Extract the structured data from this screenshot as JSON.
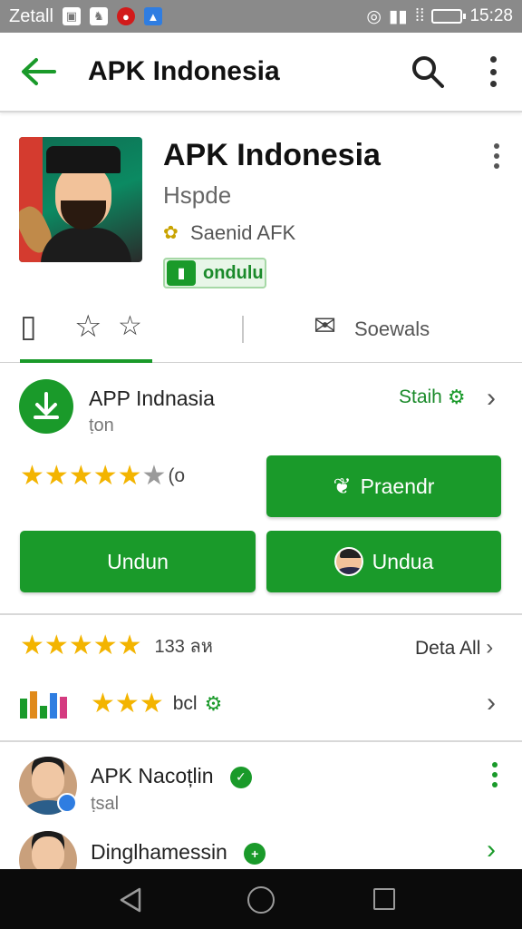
{
  "status_bar": {
    "carrier": "Zetall",
    "time": "15:28"
  },
  "app_bar": {
    "title": "APK Indonesia",
    "icons": [
      "back-arrow-icon",
      "search-icon",
      "overflow-menu-icon"
    ]
  },
  "header": {
    "app_name": "APK Indonesia",
    "subtitle": "Hspde",
    "developer": "Saenid AFK",
    "install_chip": "ondulu"
  },
  "tabs": {
    "label": "Soewals",
    "icons": [
      "like-icon",
      "star-icon",
      "star-outline-icon",
      "share-icon"
    ]
  },
  "app_row": {
    "title": "APP Indnasia",
    "subtitle": "ṭon",
    "link": "Staih",
    "rating_suffix": "(o",
    "rating": 4.5
  },
  "buttons": {
    "top_right": "Praendr",
    "bottom_left": "Undun",
    "bottom_right": "Undua"
  },
  "ratings": {
    "count": "133 ลห",
    "details_link": "Deta All",
    "stars": 5,
    "row2_text": "bcl",
    "row2_stars": 3
  },
  "people": [
    {
      "name": "APK Nacoțlin",
      "sub": "ṭsal"
    },
    {
      "name": "Dinglhamessin",
      "sub": ""
    }
  ],
  "colors": {
    "primary_green": "#1a9a2a",
    "star_yellow": "#f3b400",
    "status_bar": "#8a8a8a",
    "nav_bar": "#0b0b0b"
  }
}
